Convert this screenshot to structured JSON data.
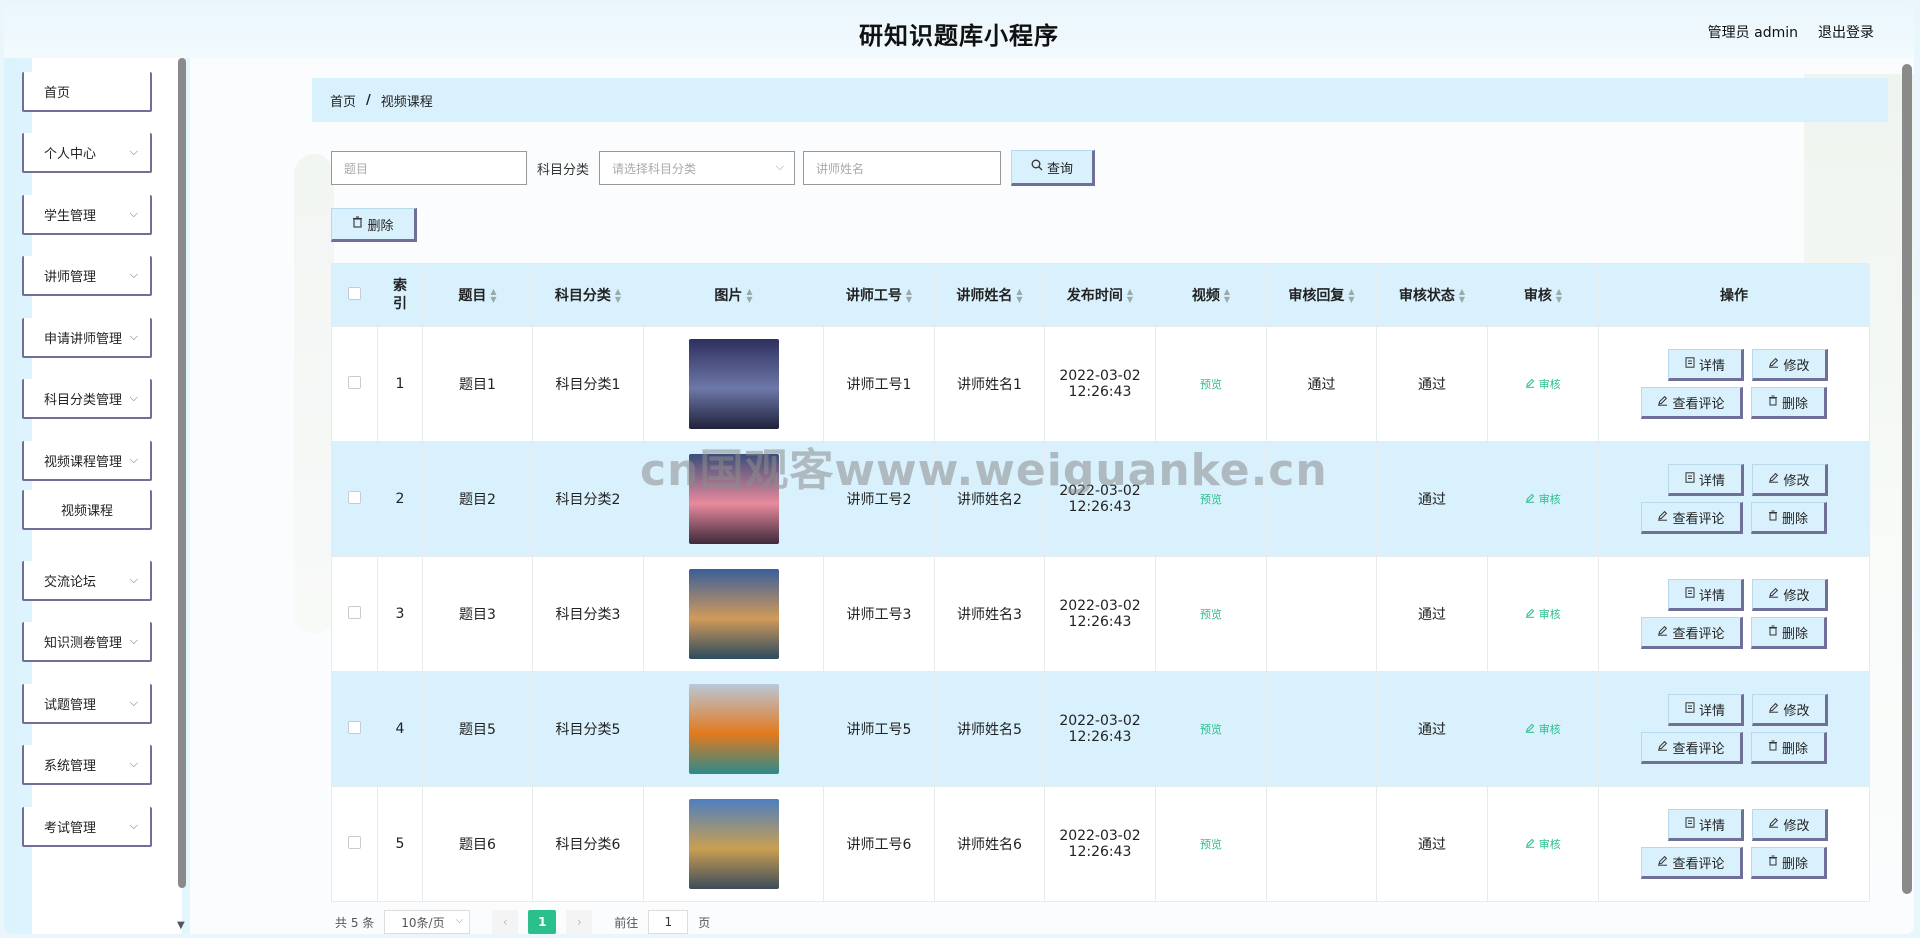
{
  "header": {
    "title": "研知识题库小程序",
    "user": "管理员 admin",
    "logout": "退出登录"
  },
  "sidebar": {
    "items": [
      {
        "label": "首页",
        "has_chevron": false
      },
      {
        "label": "个人中心",
        "has_chevron": true
      },
      {
        "label": "学生管理",
        "has_chevron": true
      },
      {
        "label": "讲师管理",
        "has_chevron": true
      },
      {
        "label": "申请讲师管理",
        "has_chevron": true
      },
      {
        "label": "科目分类管理",
        "has_chevron": true
      },
      {
        "label": "视频课程管理",
        "has_chevron": true
      },
      {
        "label": "视频课程",
        "has_chevron": false
      },
      {
        "label": "交流论坛",
        "has_chevron": true
      },
      {
        "label": "知识测卷管理",
        "has_chevron": true
      },
      {
        "label": "试题管理",
        "has_chevron": true
      },
      {
        "label": "系统管理",
        "has_chevron": true
      },
      {
        "label": "考试管理",
        "has_chevron": true
      }
    ]
  },
  "breadcrumb": {
    "home": "首页",
    "sep": "/",
    "current": "视频课程"
  },
  "search": {
    "title_placeholder": "题目",
    "category_label": "科目分类",
    "category_placeholder": "请选择科目分类",
    "teacher_placeholder": "讲师姓名",
    "query_button": "查询"
  },
  "toolbar": {
    "delete_label": "删除"
  },
  "table": {
    "headers": [
      "索引",
      "题目",
      "科目分类",
      "图片",
      "讲师工号",
      "讲师姓名",
      "发布时间",
      "视频",
      "审核回复",
      "审核状态",
      "审核",
      "操作"
    ],
    "rows": [
      {
        "index": "1",
        "title": "题目1",
        "category": "科目分类1",
        "teacher_no": "讲师工号1",
        "teacher_name": "讲师姓名1",
        "date": "2022-03-02",
        "time": "12:26:43",
        "video": "预览",
        "reply": "通过",
        "status": "通过",
        "audit": "审核"
      },
      {
        "index": "2",
        "title": "题目2",
        "category": "科目分类2",
        "teacher_no": "讲师工号2",
        "teacher_name": "讲师姓名2",
        "date": "2022-03-02",
        "time": "12:26:43",
        "video": "预览",
        "reply": "",
        "status": "通过",
        "audit": "审核"
      },
      {
        "index": "3",
        "title": "题目3",
        "category": "科目分类3",
        "teacher_no": "讲师工号3",
        "teacher_name": "讲师姓名3",
        "date": "2022-03-02",
        "time": "12:26:43",
        "video": "预览",
        "reply": "",
        "status": "通过",
        "audit": "审核"
      },
      {
        "index": "4",
        "title": "题目5",
        "category": "科目分类5",
        "teacher_no": "讲师工号5",
        "teacher_name": "讲师姓名5",
        "date": "2022-03-02",
        "time": "12:26:43",
        "video": "预览",
        "reply": "",
        "status": "通过",
        "audit": "审核"
      },
      {
        "index": "5",
        "title": "题目6",
        "category": "科目分类6",
        "teacher_no": "讲师工号6",
        "teacher_name": "讲师姓名6",
        "date": "2022-03-02",
        "time": "12:26:43",
        "video": "预览",
        "reply": "",
        "status": "通过",
        "audit": "审核"
      }
    ],
    "ops": {
      "detail": "详情",
      "edit": "修改",
      "comments": "查看评论",
      "delete": "删除"
    }
  },
  "pagination": {
    "total": "共 5 条",
    "page_size": "10条/页",
    "current_page": "1",
    "goto_prefix": "前往",
    "goto_value": "1",
    "goto_suffix": "页"
  },
  "watermark": "cn国观客www.weiguanke.cn",
  "colors": {
    "accent": "#2bbf8c",
    "light_blue": "#d8f1fd",
    "border_dark": "#6f6f98"
  },
  "thumbs": [
    {
      "top": "#2e2f5e",
      "mid": "#6d78a8",
      "bottom": "#20213b"
    },
    {
      "top": "#3b4d7a",
      "mid": "#e88a9c",
      "bottom": "#3d2a3b"
    },
    {
      "top": "#3a5e9a",
      "mid": "#d19a5a",
      "bottom": "#2c4b5f"
    },
    {
      "top": "#b8c8d8",
      "mid": "#e37a1e",
      "bottom": "#2c8a8a"
    },
    {
      "top": "#4d7fbf",
      "mid": "#c99f52",
      "bottom": "#3d4c5a"
    }
  ]
}
